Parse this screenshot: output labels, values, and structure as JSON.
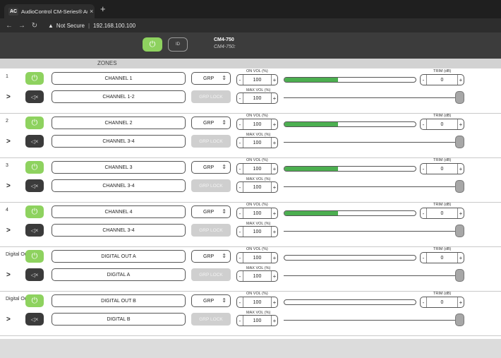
{
  "browser": {
    "tab_title": "AudioControl CM-Series® Amp",
    "favicon_text": "AC",
    "close": "×",
    "new_tab": "+",
    "security": "Not Secure",
    "url": "192.168.100.100"
  },
  "header": {
    "model": "CM4-750",
    "model_sub": "CM4-750:",
    "id_label": "ID"
  },
  "zones_label": "ZONES",
  "labels": {
    "on_vol": "ON VOL (%)",
    "max_vol": "MAX VOL (%)",
    "trim": "TRIM (dB)",
    "grp_lock": "GRP LOCK",
    "minus": "-",
    "plus": "+"
  },
  "zones": [
    {
      "num": "1",
      "name": "CHANNEL 1",
      "pair": "CHANNEL 1-2",
      "grp": "GRP",
      "on_vol": "100",
      "max_vol": "100",
      "trim": "0",
      "level": 0.41
    },
    {
      "num": "2",
      "name": "CHANNEL 2",
      "pair": "CHANNEL 3-4",
      "grp": "GRP",
      "on_vol": "100",
      "max_vol": "100",
      "trim": "0",
      "level": 0.41
    },
    {
      "num": "3",
      "name": "CHANNEL 3",
      "pair": "CHANNEL 3-4",
      "grp": "GRP",
      "on_vol": "100",
      "max_vol": "100",
      "trim": "0",
      "level": 0.41
    },
    {
      "num": "4",
      "name": "CHANNEL 4",
      "pair": "CHANNEL 3-4",
      "grp": "GRP",
      "on_vol": "100",
      "max_vol": "100",
      "trim": "0",
      "level": 0.41
    },
    {
      "num": "Digital Out A",
      "name": "DIGITAL OUT A",
      "pair": "DIGITAL A",
      "grp": "GRP",
      "on_vol": "100",
      "max_vol": "100",
      "trim": "0",
      "level": 0
    },
    {
      "num": "Digital Out B",
      "name": "DIGITAL OUT B",
      "pair": "DIGITAL B",
      "grp": "GRP",
      "on_vol": "100",
      "max_vol": "100",
      "trim": "0",
      "level": 0
    }
  ],
  "colors": {
    "power_on": "#8ed25f",
    "meter": "#4caf50"
  }
}
